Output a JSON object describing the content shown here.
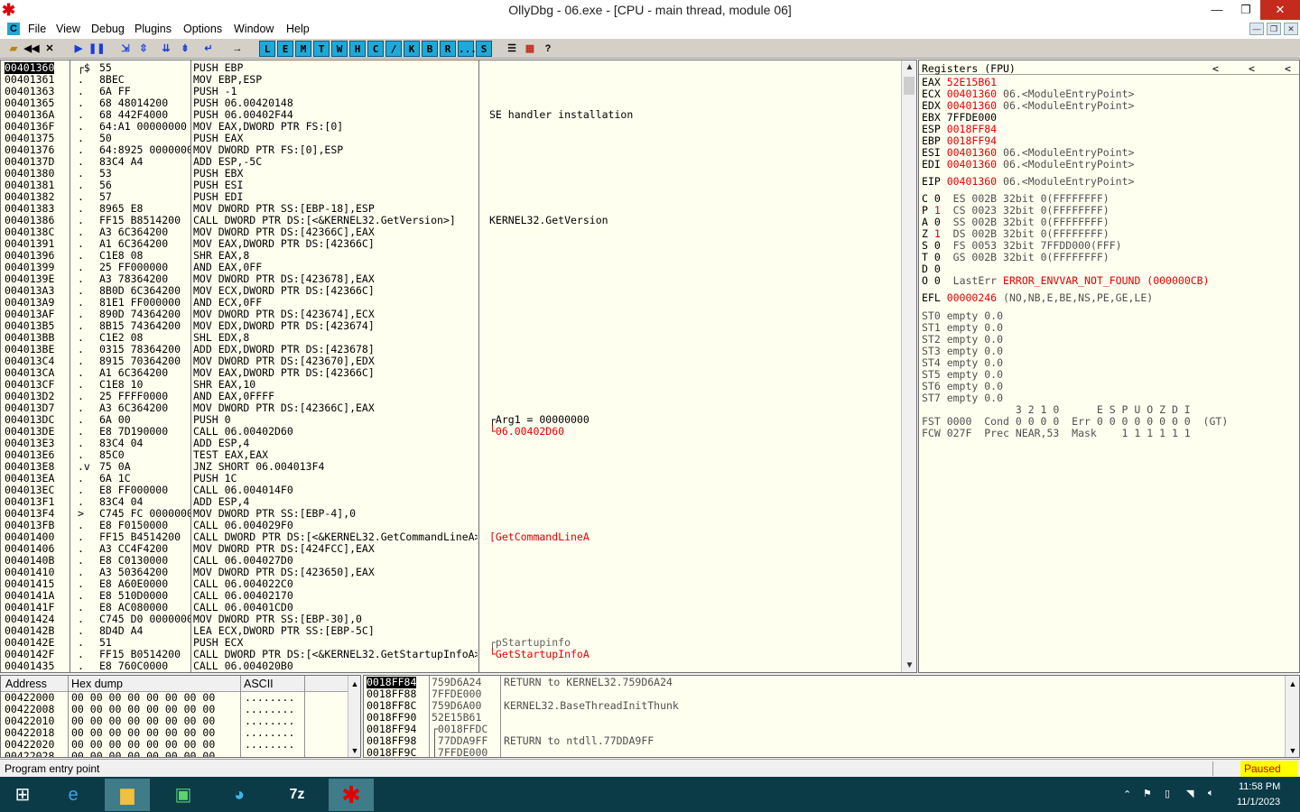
{
  "window": {
    "title": "OllyDbg - 06.exe - [CPU - main thread, module 06]",
    "min": "—",
    "restore": "❐",
    "close": "✕"
  },
  "menu": {
    "items": [
      "File",
      "View",
      "Debug",
      "Plugins",
      "Options",
      "Window",
      "Help"
    ],
    "icon_label": "C",
    "mdi": [
      "—",
      "❐",
      "✕"
    ]
  },
  "toolbar": {
    "letters": [
      "L",
      "E",
      "M",
      "T",
      "W",
      "H",
      "C",
      "/",
      "K",
      "B",
      "R",
      "...",
      "S"
    ]
  },
  "cpu": {
    "rows": [
      {
        "addr": "00401360",
        "mark": "┌$",
        "bytes": "55",
        "dis": "PUSH EBP",
        "comment": "",
        "sel": true
      },
      {
        "addr": "00401361",
        "mark": ".",
        "bytes": "8BEC",
        "dis": "MOV EBP,ESP",
        "comment": ""
      },
      {
        "addr": "00401363",
        "mark": ".",
        "bytes": "6A FF",
        "dis": "PUSH -1",
        "comment": ""
      },
      {
        "addr": "00401365",
        "mark": ".",
        "bytes": "68 48014200",
        "dis": "PUSH 06.00420148",
        "comment": ""
      },
      {
        "addr": "0040136A",
        "mark": ".",
        "bytes": "68 442F4000",
        "dis": "PUSH 06.00402F44",
        "comment": "SE handler installation"
      },
      {
        "addr": "0040136F",
        "mark": ".",
        "bytes": "64:A1 00000000",
        "dis": "MOV EAX,DWORD PTR FS:[0]",
        "comment": ""
      },
      {
        "addr": "00401375",
        "mark": ".",
        "bytes": "50",
        "dis": "PUSH EAX",
        "comment": ""
      },
      {
        "addr": "00401376",
        "mark": ".",
        "bytes": "64:8925 00000000",
        "dis": "MOV DWORD PTR FS:[0],ESP",
        "comment": ""
      },
      {
        "addr": "0040137D",
        "mark": ".",
        "bytes": "83C4 A4",
        "dis": "ADD ESP,-5C",
        "comment": ""
      },
      {
        "addr": "00401380",
        "mark": ".",
        "bytes": "53",
        "dis": "PUSH EBX",
        "comment": ""
      },
      {
        "addr": "00401381",
        "mark": ".",
        "bytes": "56",
        "dis": "PUSH ESI",
        "comment": ""
      },
      {
        "addr": "00401382",
        "mark": ".",
        "bytes": "57",
        "dis": "PUSH EDI",
        "comment": ""
      },
      {
        "addr": "00401383",
        "mark": ".",
        "bytes": "8965 E8",
        "dis": "MOV DWORD PTR SS:[EBP-18],ESP",
        "comment": ""
      },
      {
        "addr": "00401386",
        "mark": ".",
        "bytes": "FF15 B8514200",
        "dis": "CALL DWORD PTR DS:[<&KERNEL32.GetVersion>]",
        "comment": "KERNEL32.GetVersion"
      },
      {
        "addr": "0040138C",
        "mark": ".",
        "bytes": "A3 6C364200",
        "dis": "MOV DWORD PTR DS:[42366C],EAX",
        "comment": ""
      },
      {
        "addr": "00401391",
        "mark": ".",
        "bytes": "A1 6C364200",
        "dis": "MOV EAX,DWORD PTR DS:[42366C]",
        "comment": ""
      },
      {
        "addr": "00401396",
        "mark": ".",
        "bytes": "C1E8 08",
        "dis": "SHR EAX,8",
        "comment": ""
      },
      {
        "addr": "00401399",
        "mark": ".",
        "bytes": "25 FF000000",
        "dis": "AND EAX,0FF",
        "comment": ""
      },
      {
        "addr": "0040139E",
        "mark": ".",
        "bytes": "A3 78364200",
        "dis": "MOV DWORD PTR DS:[423678],EAX",
        "comment": ""
      },
      {
        "addr": "004013A3",
        "mark": ".",
        "bytes": "8B0D 6C364200",
        "dis": "MOV ECX,DWORD PTR DS:[42366C]",
        "comment": ""
      },
      {
        "addr": "004013A9",
        "mark": ".",
        "bytes": "81E1 FF000000",
        "dis": "AND ECX,0FF",
        "comment": ""
      },
      {
        "addr": "004013AF",
        "mark": ".",
        "bytes": "890D 74364200",
        "dis": "MOV DWORD PTR DS:[423674],ECX",
        "comment": ""
      },
      {
        "addr": "004013B5",
        "mark": ".",
        "bytes": "8B15 74364200",
        "dis": "MOV EDX,DWORD PTR DS:[423674]",
        "comment": ""
      },
      {
        "addr": "004013BB",
        "mark": ".",
        "bytes": "C1E2 08",
        "dis": "SHL EDX,8",
        "comment": ""
      },
      {
        "addr": "004013BE",
        "mark": ".",
        "bytes": "0315 78364200",
        "dis": "ADD EDX,DWORD PTR DS:[423678]",
        "comment": ""
      },
      {
        "addr": "004013C4",
        "mark": ".",
        "bytes": "8915 70364200",
        "dis": "MOV DWORD PTR DS:[423670],EDX",
        "comment": ""
      },
      {
        "addr": "004013CA",
        "mark": ".",
        "bytes": "A1 6C364200",
        "dis": "MOV EAX,DWORD PTR DS:[42366C]",
        "comment": ""
      },
      {
        "addr": "004013CF",
        "mark": ".",
        "bytes": "C1E8 10",
        "dis": "SHR EAX,10",
        "comment": ""
      },
      {
        "addr": "004013D2",
        "mark": ".",
        "bytes": "25 FFFF0000",
        "dis": "AND EAX,0FFFF",
        "comment": ""
      },
      {
        "addr": "004013D7",
        "mark": ".",
        "bytes": "A3 6C364200",
        "dis": "MOV DWORD PTR DS:[42366C],EAX",
        "comment": ""
      },
      {
        "addr": "004013DC",
        "mark": ".",
        "bytes": "6A 00",
        "dis": "PUSH 0",
        "comment": "┌Arg1 = 00000000"
      },
      {
        "addr": "004013DE",
        "mark": ".",
        "bytes": "E8 7D190000",
        "dis": "CALL 06.00402D60",
        "comment": "└06.00402D60",
        "red": true
      },
      {
        "addr": "004013E3",
        "mark": ".",
        "bytes": "83C4 04",
        "dis": "ADD ESP,4",
        "comment": ""
      },
      {
        "addr": "004013E6",
        "mark": ".",
        "bytes": "85C0",
        "dis": "TEST EAX,EAX",
        "comment": ""
      },
      {
        "addr": "004013E8",
        "mark": ".v",
        "bytes": "75 0A",
        "dis": "JNZ SHORT 06.004013F4",
        "comment": ""
      },
      {
        "addr": "004013EA",
        "mark": ".",
        "bytes": "6A 1C",
        "dis": "PUSH 1C",
        "comment": ""
      },
      {
        "addr": "004013EC",
        "mark": ".",
        "bytes": "E8 FF000000",
        "dis": "CALL 06.004014F0",
        "comment": ""
      },
      {
        "addr": "004013F1",
        "mark": ".",
        "bytes": "83C4 04",
        "dis": "ADD ESP,4",
        "comment": ""
      },
      {
        "addr": "004013F4",
        "mark": ">",
        "bytes": "C745 FC 00000000",
        "dis": "MOV DWORD PTR SS:[EBP-4],0",
        "comment": ""
      },
      {
        "addr": "004013FB",
        "mark": ".",
        "bytes": "E8 F0150000",
        "dis": "CALL 06.004029F0",
        "comment": ""
      },
      {
        "addr": "00401400",
        "mark": ".",
        "bytes": "FF15 B4514200",
        "dis": "CALL DWORD PTR DS:[<&KERNEL32.GetCommandLineA>]",
        "comment": "[GetCommandLineA",
        "red": true
      },
      {
        "addr": "00401406",
        "mark": ".",
        "bytes": "A3 CC4F4200",
        "dis": "MOV DWORD PTR DS:[424FCC],EAX",
        "comment": ""
      },
      {
        "addr": "0040140B",
        "mark": ".",
        "bytes": "E8 C0130000",
        "dis": "CALL 06.004027D0",
        "comment": ""
      },
      {
        "addr": "00401410",
        "mark": ".",
        "bytes": "A3 50364200",
        "dis": "MOV DWORD PTR DS:[423650],EAX",
        "comment": ""
      },
      {
        "addr": "00401415",
        "mark": ".",
        "bytes": "E8 A60E0000",
        "dis": "CALL 06.004022C0",
        "comment": ""
      },
      {
        "addr": "0040141A",
        "mark": ".",
        "bytes": "E8 510D0000",
        "dis": "CALL 06.00402170",
        "comment": ""
      },
      {
        "addr": "0040141F",
        "mark": ".",
        "bytes": "E8 AC080000",
        "dis": "CALL 06.00401CD0",
        "comment": ""
      },
      {
        "addr": "00401424",
        "mark": ".",
        "bytes": "C745 D0 00000000",
        "dis": "MOV DWORD PTR SS:[EBP-30],0",
        "comment": ""
      },
      {
        "addr": "0040142B",
        "mark": ".",
        "bytes": "8D4D A4",
        "dis": "LEA ECX,DWORD PTR SS:[EBP-5C]",
        "comment": ""
      },
      {
        "addr": "0040142E",
        "mark": ".",
        "bytes": "51",
        "dis": "PUSH ECX",
        "comment": "┌pStartupinfo",
        "gray": true
      },
      {
        "addr": "0040142F",
        "mark": ".",
        "bytes": "FF15 B0514200",
        "dis": "CALL DWORD PTR DS:[<&KERNEL32.GetStartupInfoA>]",
        "comment": "└GetStartupInfoA",
        "red": true
      },
      {
        "addr": "00401435",
        "mark": ".",
        "bytes": "E8 760C0000",
        "dis": "CALL 06.004020B0",
        "comment": ""
      }
    ]
  },
  "registers": {
    "header": "Registers (FPU)",
    "nav": [
      "<",
      "<",
      "<"
    ],
    "lines": [
      {
        "t": "EAX ",
        "v": "52E15B61",
        "r": "",
        "red": true
      },
      {
        "t": "ECX ",
        "v": "00401360",
        "r": " 06.<ModuleEntryPoint>",
        "red": true
      },
      {
        "t": "EDX ",
        "v": "00401360",
        "r": " 06.<ModuleEntryPoint>",
        "red": true
      },
      {
        "t": "EBX ",
        "v": "7FFDE000",
        "r": "",
        "red": false
      },
      {
        "t": "ESP ",
        "v": "0018FF84",
        "r": "",
        "red": true
      },
      {
        "t": "EBP ",
        "v": "0018FF94",
        "r": "",
        "red": true
      },
      {
        "t": "ESI ",
        "v": "00401360",
        "r": " 06.<ModuleEntryPoint>",
        "red": true
      },
      {
        "t": "EDI ",
        "v": "00401360",
        "r": " 06.<ModuleEntryPoint>",
        "red": true
      }
    ],
    "eip": {
      "t": "EIP ",
      "v": "00401360",
      "r": " 06.<ModuleEntryPoint>"
    },
    "flags": [
      {
        "f": "C 0",
        "seg": "  ES 002B 32bit 0(FFFFFFFF)",
        "red": false
      },
      {
        "f": "P 1",
        "seg": "  CS 0023 32bit 0(FFFFFFFF)",
        "red": true
      },
      {
        "f": "A 0",
        "seg": "  SS 002B 32bit 0(FFFFFFFF)",
        "red": false
      },
      {
        "f": "Z 1",
        "seg": "  DS 002B 32bit 0(FFFFFFFF)",
        "red": true
      },
      {
        "f": "S 0",
        "seg": "  FS 0053 32bit 7FFDD000(FFF)",
        "red": false
      },
      {
        "f": "T 0",
        "seg": "  GS 002B 32bit 0(FFFFFFFF)",
        "red": false
      },
      {
        "f": "D 0",
        "seg": "",
        "red": false
      },
      {
        "f": "O 0",
        "seg": "  LastErr ",
        "red": false
      }
    ],
    "lasterr": "ERROR_ENVVAR_NOT_FOUND (000000CB)",
    "efl": {
      "t": "EFL ",
      "v": "00000246",
      "r": " (NO,NB,E,BE,NS,PE,GE,LE)"
    },
    "fpu": [
      "ST0 empty 0.0",
      "ST1 empty 0.0",
      "ST2 empty 0.0",
      "ST3 empty 0.0",
      "ST4 empty 0.0",
      "ST5 empty 0.0",
      "ST6 empty 0.0",
      "ST7 empty 0.0"
    ],
    "fst_hdr": "               3 2 1 0      E S P U O Z D I",
    "fst": "FST 0000  Cond 0 0 0 0  Err 0 0 0 0 0 0 0 0  (GT)",
    "fcw": "FCW 027F  Prec NEAR,53  Mask    1 1 1 1 1 1"
  },
  "dump": {
    "headers": {
      "address": "Address",
      "hex": "Hex dump",
      "ascii": "ASCII"
    },
    "rows": [
      {
        "a": "00422000",
        "h": "00 00 00 00 00 00 00 00",
        "s": "........"
      },
      {
        "a": "00422008",
        "h": "00 00 00 00 00 00 00 00",
        "s": "........"
      },
      {
        "a": "00422010",
        "h": "00 00 00 00 00 00 00 00",
        "s": "........"
      },
      {
        "a": "00422018",
        "h": "00 00 00 00 00 00 00 00",
        "s": "........"
      },
      {
        "a": "00422020",
        "h": "00 00 00 00 00 00 00 00",
        "s": "........"
      },
      {
        "a": "00422028",
        "h": "00 00 00 00 00 00 00 00",
        "s": "........"
      }
    ]
  },
  "stack": {
    "rows": [
      {
        "a": "0018FF84",
        "v": "759D6A24",
        "c": "RETURN to KERNEL32.759D6A24",
        "sel": true
      },
      {
        "a": "0018FF88",
        "v": "7FFDE000",
        "c": ""
      },
      {
        "a": "0018FF8C",
        "v": "759D6A00",
        "c": "KERNEL32.BaseThreadInitThunk"
      },
      {
        "a": "0018FF90",
        "v": "52E15B61",
        "c": ""
      },
      {
        "a": "0018FF94",
        "v": "┌0018FFDC",
        "c": ""
      },
      {
        "a": "0018FF98",
        "v": "│77DDA9FF",
        "c": "RETURN to ntdll.77DDA9FF"
      },
      {
        "a": "0018FF9C",
        "v": "│7FFDE000",
        "c": ""
      }
    ]
  },
  "status": {
    "message": "Program entry point",
    "state": "Paused"
  },
  "taskbar": {
    "time": "11:58 PM",
    "date": "11/1/2023"
  }
}
